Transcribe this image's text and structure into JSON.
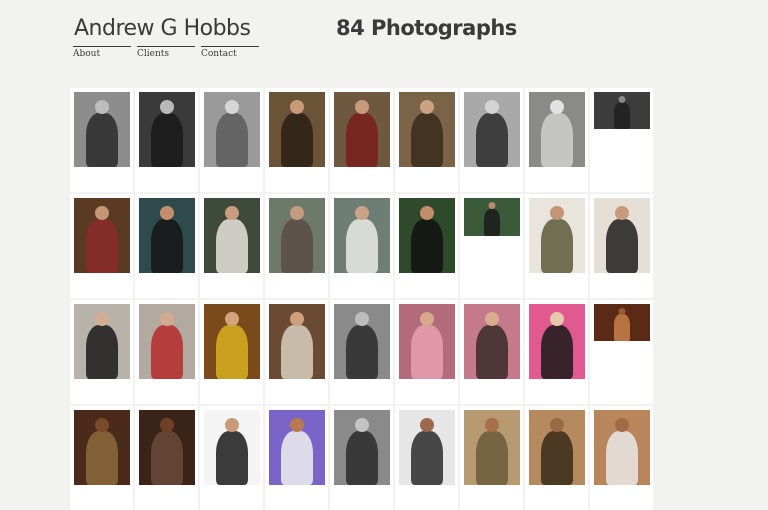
{
  "header": {
    "site_title": "Andrew G Hobbs",
    "count_title": "84 Photographs"
  },
  "nav": {
    "items": [
      {
        "label": "About",
        "id": "about"
      },
      {
        "label": "Clients",
        "id": "clients"
      },
      {
        "label": "Contact",
        "id": "contact"
      }
    ]
  },
  "photos": [
    {
      "shape": "portrait",
      "bg": "#8d8d8d",
      "fig": "#2a2a2a",
      "skin": "#bdbdbd"
    },
    {
      "shape": "portrait",
      "bg": "#3a3a3a",
      "fig": "#1a1a1a",
      "skin": "#b9b9b9"
    },
    {
      "shape": "portrait",
      "bg": "#9a9a9a",
      "fig": "#5a5a5a",
      "skin": "#d6d6d6"
    },
    {
      "shape": "portrait",
      "bg": "#6b5338",
      "fig": "#2a1e14",
      "skin": "#c89a78"
    },
    {
      "shape": "portrait",
      "bg": "#6e5840",
      "fig": "#7a1d1d",
      "skin": "#c79a7a"
    },
    {
      "shape": "portrait",
      "bg": "#7a6346",
      "fig": "#3a2a1c",
      "skin": "#caa283"
    },
    {
      "shape": "portrait",
      "bg": "#a9a9a9",
      "fig": "#2c2c2c",
      "skin": "#d4d4d4"
    },
    {
      "shape": "portrait",
      "bg": "#8a8a88",
      "fig": "#cfcfcf",
      "skin": "#e2e2e2"
    },
    {
      "shape": "landscape",
      "bg": "#3c3c3c",
      "fig": "#1f1f1f",
      "skin": "#8a8a8a"
    },
    {
      "shape": "portrait",
      "bg": "#5a3a22",
      "fig": "#8b2a2a",
      "skin": "#c59674"
    },
    {
      "shape": "portrait",
      "bg": "#2f4a4d",
      "fig": "#151515",
      "skin": "#c28e6c"
    },
    {
      "shape": "portrait",
      "bg": "#3e4a3a",
      "fig": "#e8e4de",
      "skin": "#c89c7c"
    },
    {
      "shape": "portrait",
      "bg": "#6d7a6a",
      "fig": "#5a4c44",
      "skin": "#c49a80"
    },
    {
      "shape": "portrait",
      "bg": "#6e7e74",
      "fig": "#eaeae6",
      "skin": "#caa287"
    },
    {
      "shape": "portrait",
      "bg": "#2f4a2a",
      "fig": "#121212",
      "skin": "#c08c6c"
    },
    {
      "shape": "short",
      "bg": "#3a5a3a",
      "fig": "#1b1b1b",
      "skin": "#b68a6c"
    },
    {
      "shape": "portrait",
      "bg": "#e9e4dc",
      "fig": "#5a5a38",
      "skin": "#c39476"
    },
    {
      "shape": "portrait",
      "bg": "#e6dfd6",
      "fig": "#1e1e1e",
      "skin": "#c79b7c"
    },
    {
      "shape": "portrait",
      "bg": "#b8b2aa",
      "fig": "#1a1a1a",
      "skin": "#d2ad93"
    },
    {
      "shape": "portrait",
      "bg": "#b2aaa0",
      "fig": "#b52a2a",
      "skin": "#d1aa8f"
    },
    {
      "shape": "portrait",
      "bg": "#7a4a1a",
      "fig": "#d8b020",
      "skin": "#d6a27c"
    },
    {
      "shape": "portrait",
      "bg": "#6a4a32",
      "fig": "#d8cfc0",
      "skin": "#d0a07c"
    },
    {
      "shape": "portrait",
      "bg": "#8a8a8a",
      "fig": "#2a2a2a",
      "skin": "#bcbcbc"
    },
    {
      "shape": "portrait",
      "bg": "#b36a7a",
      "fig": "#e8a0b0",
      "skin": "#d6a88c"
    },
    {
      "shape": "portrait",
      "bg": "#c47a8a",
      "fig": "#3a2a2a",
      "skin": "#d8ac90"
    },
    {
      "shape": "portrait",
      "bg": "#e05a90",
      "fig": "#1a1a1a",
      "skin": "#e6c9a8"
    },
    {
      "shape": "landscape",
      "bg": "#5a2a16",
      "fig": "#c9804a",
      "skin": "#9a5a34"
    },
    {
      "shape": "portrait",
      "bg": "#4a2a1a",
      "fig": "#8a6a3a",
      "skin": "#7a4a2a"
    },
    {
      "shape": "portrait",
      "bg": "#3a2418",
      "fig": "#6a4a3a",
      "skin": "#6e4028"
    },
    {
      "shape": "portrait",
      "bg": "#f4f4f4",
      "fig": "#1a1a1a",
      "skin": "#c89a7a"
    },
    {
      "shape": "portrait",
      "bg": "#7a64c8",
      "fig": "#eeeeee",
      "skin": "#b77a52"
    },
    {
      "shape": "portrait",
      "bg": "#8a8a8a",
      "fig": "#2a2a2a",
      "skin": "#c4c4c4"
    },
    {
      "shape": "portrait",
      "bg": "#e6e6e6",
      "fig": "#2a2a2a",
      "skin": "#9a6a4a"
    },
    {
      "shape": "portrait",
      "bg": "#b89a72",
      "fig": "#6a5a3a",
      "skin": "#a8704a"
    },
    {
      "shape": "portrait",
      "bg": "#b48a5e",
      "fig": "#3a2a1a",
      "skin": "#9a6a44"
    },
    {
      "shape": "portrait",
      "bg": "#b8865a",
      "fig": "#e8e8e8",
      "skin": "#a06a44"
    }
  ]
}
